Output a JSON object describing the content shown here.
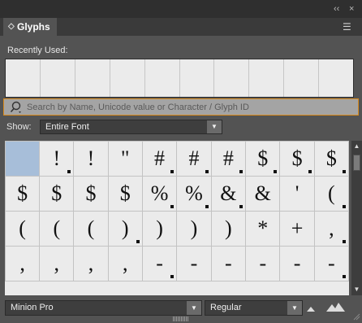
{
  "window": {
    "collapse_icon": "double-chevron-right-icon",
    "close_icon": "close-icon",
    "collapse_glyph": "‹‹",
    "close_glyph": "×"
  },
  "panel": {
    "tab_label": "Glyphs",
    "tab_icon": "updown-arrows-icon",
    "tab_icon_glyph": "◇",
    "menu_icon": "panel-menu-icon",
    "menu_glyph": "☰"
  },
  "recently_used": {
    "label": "Recently Used:",
    "cells": [
      "",
      "",
      "",
      "",
      "",
      "",
      "",
      "",
      "",
      ""
    ]
  },
  "search": {
    "placeholder": "Search by Name, Unicode value or Character / Glyph ID",
    "value": "",
    "icon": "search-icon"
  },
  "show": {
    "label": "Show:",
    "value": "Entire Font",
    "arrow": "▼"
  },
  "glyph_grid": {
    "rows": [
      [
        {
          "g": "",
          "m": false,
          "sel": true
        },
        {
          "g": "!",
          "m": true
        },
        {
          "g": "!",
          "m": false
        },
        {
          "g": "\"",
          "m": false
        },
        {
          "g": "#",
          "m": true
        },
        {
          "g": "#",
          "m": true
        },
        {
          "g": "#",
          "m": true
        },
        {
          "g": "$",
          "m": true
        },
        {
          "g": "$",
          "m": true
        },
        {
          "g": "$",
          "m": true
        }
      ],
      [
        {
          "g": "$",
          "m": false
        },
        {
          "g": "$",
          "m": false
        },
        {
          "g": "$",
          "m": false
        },
        {
          "g": "$",
          "m": false
        },
        {
          "g": "%",
          "m": true
        },
        {
          "g": "%",
          "m": true
        },
        {
          "g": "&",
          "m": true
        },
        {
          "g": "&",
          "m": false
        },
        {
          "g": "'",
          "m": false
        },
        {
          "g": "(",
          "m": true
        }
      ],
      [
        {
          "g": "(",
          "m": false
        },
        {
          "g": "(",
          "m": false
        },
        {
          "g": "(",
          "m": false
        },
        {
          "g": ")",
          "m": true
        },
        {
          "g": ")",
          "m": false
        },
        {
          "g": ")",
          "m": false
        },
        {
          "g": ")",
          "m": false
        },
        {
          "g": "*",
          "m": false
        },
        {
          "g": "+",
          "m": false
        },
        {
          "g": ",",
          "m": true
        }
      ],
      [
        {
          "g": ",",
          "m": false
        },
        {
          "g": ",",
          "m": false
        },
        {
          "g": ",",
          "m": false
        },
        {
          "g": ",",
          "m": false
        },
        {
          "g": "-",
          "m": true
        },
        {
          "g": "-",
          "m": false
        },
        {
          "g": "-",
          "m": false
        },
        {
          "g": "-",
          "m": false
        },
        {
          "g": "-",
          "m": false
        },
        {
          "g": "-",
          "m": true
        }
      ]
    ]
  },
  "scrollbar": {
    "up_arrow": "▲",
    "down_arrow": "▼"
  },
  "footer": {
    "font_family": "Minion Pro",
    "font_style": "Regular",
    "arrow": "▼",
    "zoom_out_icon": "small-mountains-icon",
    "zoom_in_icon": "large-mountains-icon"
  },
  "colors": {
    "panel_bg": "#535353",
    "grid_bg": "#ebebeb",
    "selected_cell": "#a7bed9",
    "search_border": "#d88a1c"
  }
}
